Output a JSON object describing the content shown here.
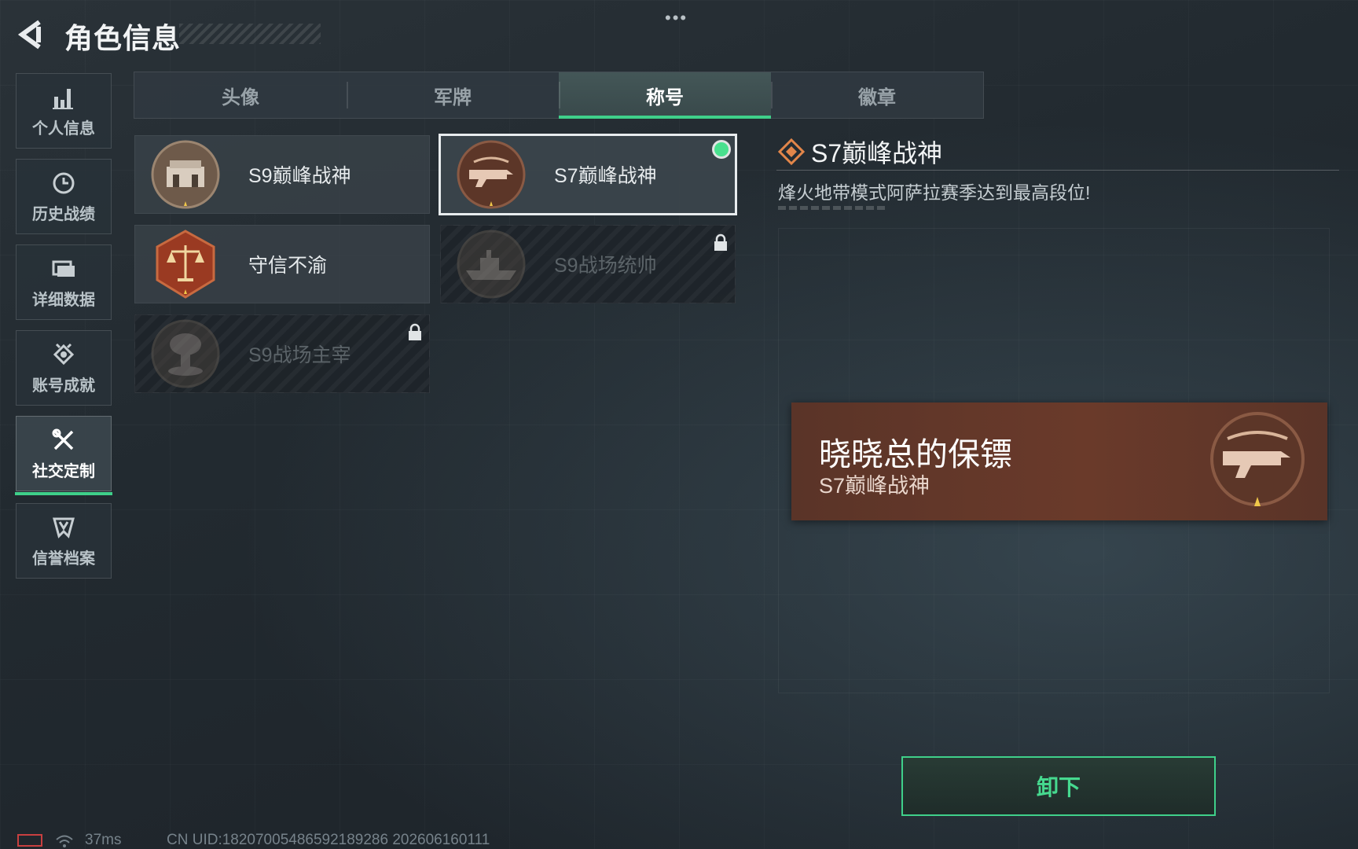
{
  "header": {
    "title": "角色信息",
    "more_label": "•••"
  },
  "sidebar": {
    "items": [
      {
        "label": "个人信息",
        "icon": "bar-chart-icon"
      },
      {
        "label": "历史战绩",
        "icon": "clock-icon"
      },
      {
        "label": "详细数据",
        "icon": "folder-icon"
      },
      {
        "label": "账号成就",
        "icon": "medal-icon"
      },
      {
        "label": "社交定制",
        "icon": "tools-icon",
        "active": true
      },
      {
        "label": "信誉档案",
        "icon": "shield-icon"
      }
    ]
  },
  "tabs": [
    {
      "label": "头像"
    },
    {
      "label": "军牌"
    },
    {
      "label": "称号",
      "active": true
    },
    {
      "label": "徽章"
    }
  ],
  "titles": [
    {
      "name": "S9巅峰战神",
      "badge": "fortress-badge-icon",
      "locked": false
    },
    {
      "name": "S7巅峰战神",
      "badge": "rifle-badge-icon",
      "locked": false,
      "selected": true,
      "equipped": true
    },
    {
      "name": "守信不渝",
      "badge": "scales-badge-icon",
      "locked": false
    },
    {
      "name": "S9战场统帅",
      "badge": "warship-badge-icon",
      "locked": true
    },
    {
      "name": "S9战场主宰",
      "badge": "explosion-badge-icon",
      "locked": true
    }
  ],
  "detail": {
    "title": "S7巅峰战神",
    "description": "烽火地带模式阿萨拉赛季达到最高段位!"
  },
  "preview": {
    "player_name": "晓晓总的保镖",
    "title": "S7巅峰战神"
  },
  "action": {
    "unequip_label": "卸下"
  },
  "footer": {
    "ping": "37ms",
    "uid": "CN UID:18207005486592189286 202606160111"
  },
  "colors": {
    "accent": "#3fd08a",
    "preview_bg": "#6a3a2a",
    "detail_icon": "#e2864a"
  }
}
